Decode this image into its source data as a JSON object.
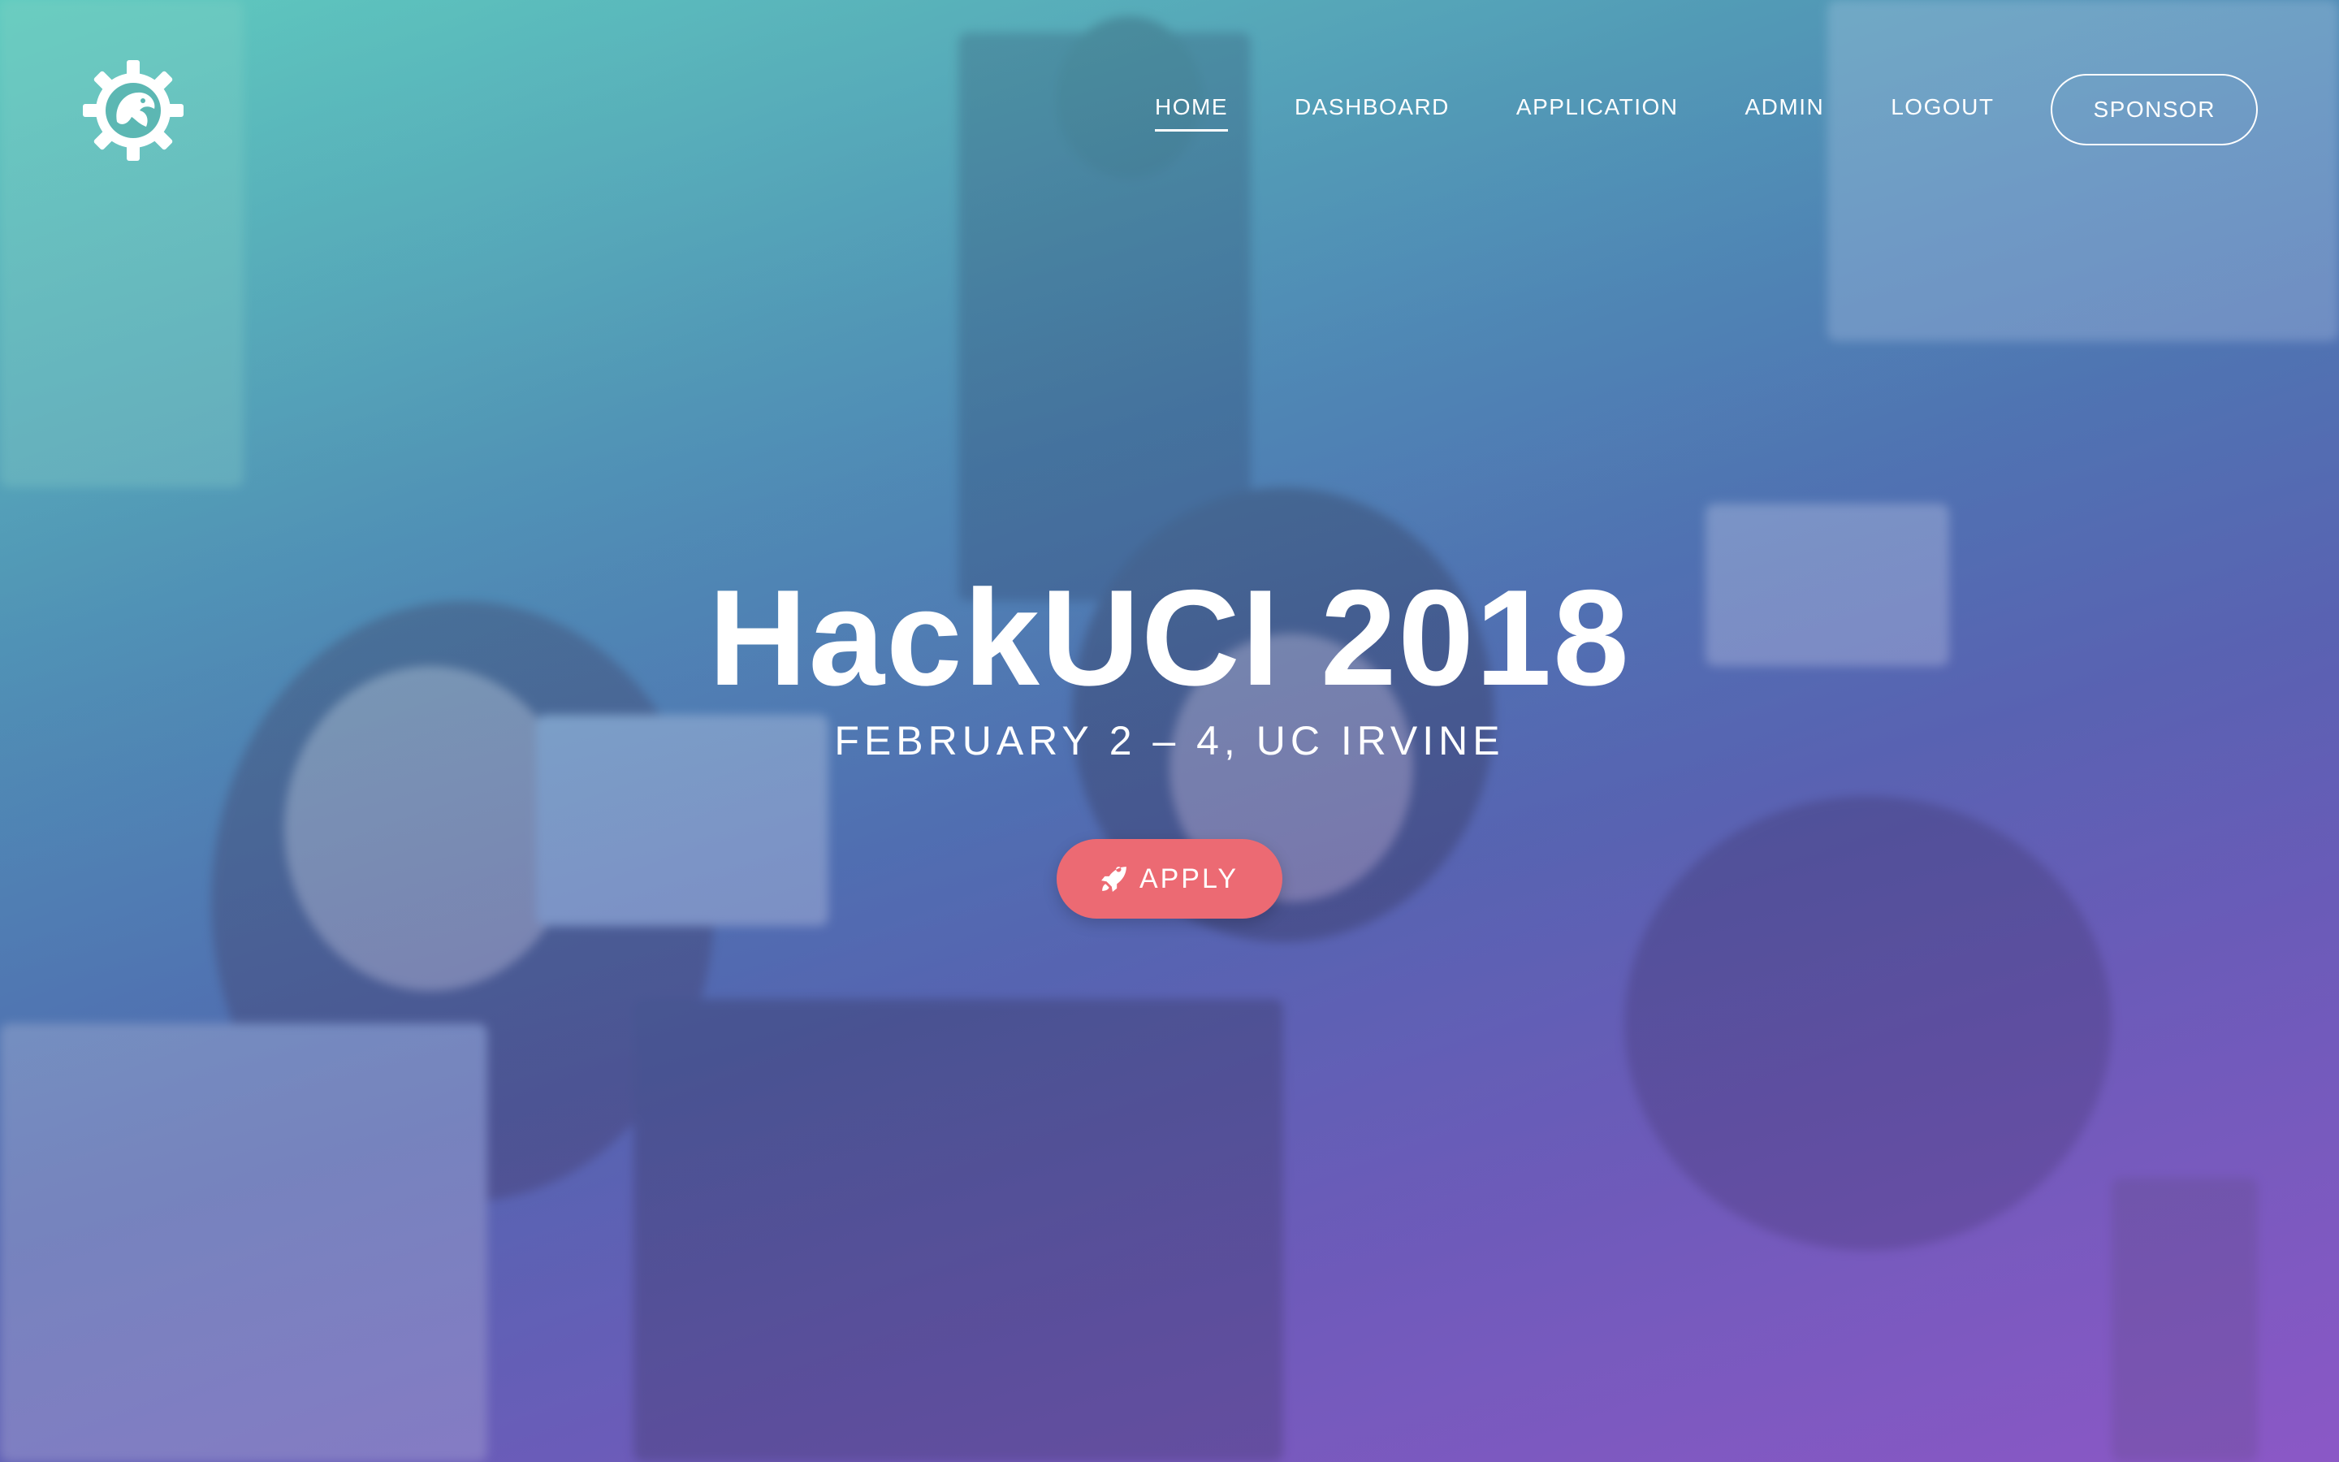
{
  "nav": {
    "logo_icon": "gear-anteater-logo-icon",
    "items": [
      {
        "label": "HOME",
        "active": true
      },
      {
        "label": "DASHBOARD",
        "active": false
      },
      {
        "label": "APPLICATION",
        "active": false
      },
      {
        "label": "ADMIN",
        "active": false
      },
      {
        "label": "LOGOUT",
        "active": false
      }
    ],
    "sponsor_label": "SPONSOR"
  },
  "hero": {
    "title": "HackUCI 2018",
    "subtitle": "FEBRUARY 2 – 4, UC IRVINE",
    "apply_label": "APPLY",
    "apply_icon": "rocket-icon",
    "apply_color": "#ec6a73"
  },
  "colors": {
    "gradient_start": "#5fc7bf",
    "gradient_end": "#8a5bc4",
    "text": "#ffffff"
  }
}
